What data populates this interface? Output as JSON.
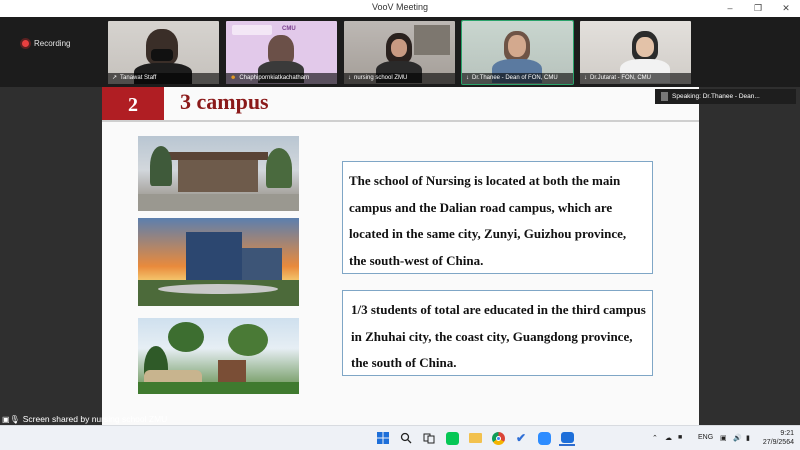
{
  "window": {
    "title": "VooV Meeting",
    "controls": [
      "–",
      "❐",
      "✕"
    ]
  },
  "recording": {
    "label": "Recording"
  },
  "participants": [
    {
      "name": "Tanawat Staff",
      "mic": "↗"
    },
    {
      "name": "Chaphipornkiatkachatharn",
      "mic": "☻"
    },
    {
      "name": "nursing school ZMU",
      "mic": "↓"
    },
    {
      "name": "Dr.Thanee - Dean of FON, CMU",
      "mic": "↓"
    },
    {
      "name": "Dr.Jutarat - FON, CMU",
      "mic": "↓"
    }
  ],
  "speaking": {
    "label": "Speaking: Dr.Thanee - Dean..."
  },
  "slide": {
    "number": "2",
    "title": "3 campus",
    "box1": "The school of Nursing is located at both the main campus and the Dalian road campus, which are located in the same city, Zunyi, Guizhou province, the south-west of China.",
    "box2": "1/3 students of total are educated in the third campus in Zhuhai city, the coast city, Guangdong province, the south of China."
  },
  "share_status": {
    "label": "Screen shared by nursing school ZMU"
  },
  "taskbar": {
    "language": "ENG",
    "time": "9:21",
    "date": "27/9/2564"
  },
  "colors": {
    "slide_title": "#8b1a1a",
    "slide_number_bg": "#b01e23",
    "textbox_border": "#7fa6c6",
    "active_speaker": "#2aa36b"
  }
}
